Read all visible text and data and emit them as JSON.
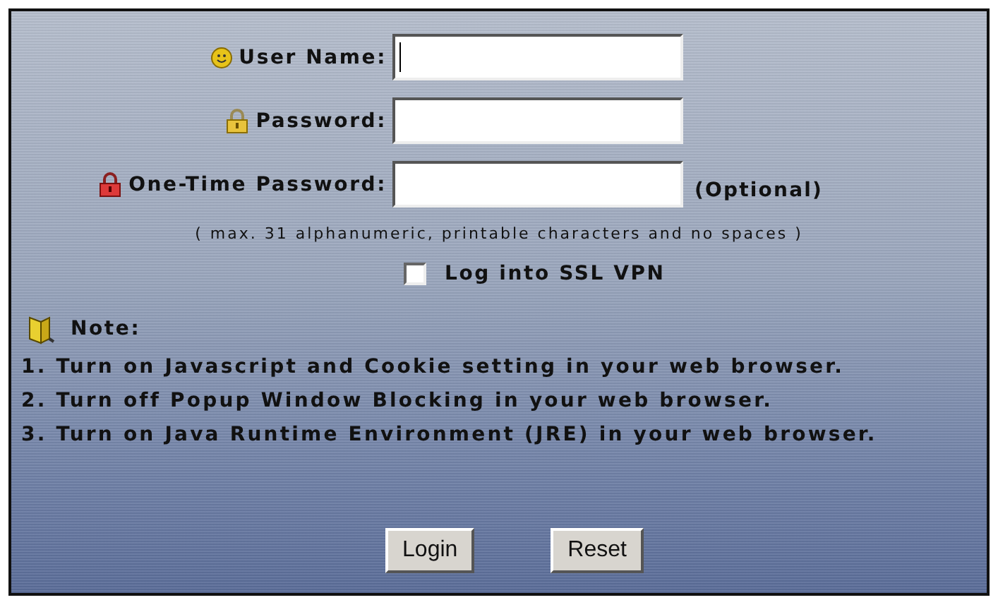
{
  "fields": [
    {
      "kind": "user",
      "label": "User Name:",
      "focused": true
    },
    {
      "kind": "password",
      "label": "Password:",
      "focused": false
    },
    {
      "kind": "otp",
      "label": "One-Time Password:",
      "focused": false,
      "suffix": "(Optional)"
    }
  ],
  "hint": "( max. 31 alphanumeric, printable characters and no spaces )",
  "ssl_vpn": {
    "label": "Log into SSL VPN",
    "checked": false
  },
  "note": {
    "title": "Note:",
    "items": [
      "1. Turn on Javascript and Cookie setting in your web browser.",
      "2. Turn off Popup Window Blocking in your web browser.",
      "3. Turn on Java Runtime Environment (JRE) in your web browser."
    ]
  },
  "buttons": [
    "Login",
    "Reset"
  ]
}
